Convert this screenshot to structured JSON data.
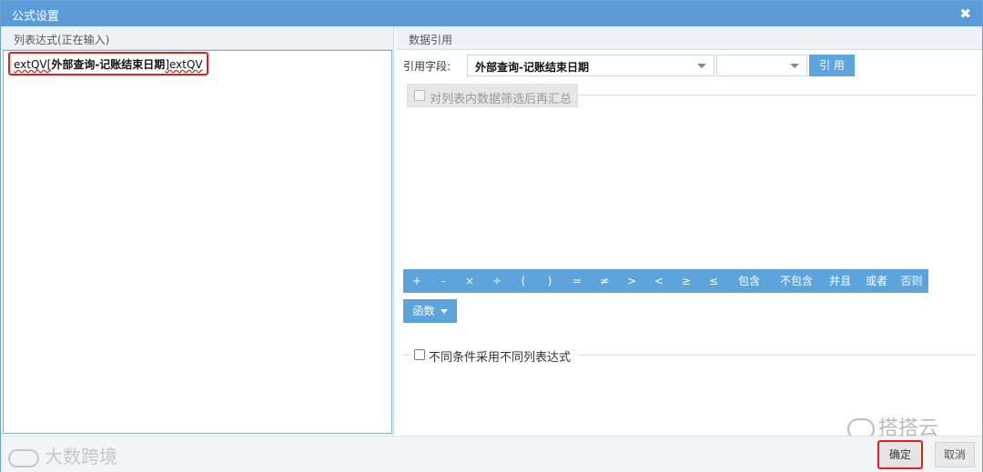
{
  "dialog": {
    "title": "公式设置",
    "close_glyph": "✖"
  },
  "left_pane": {
    "header": "列表达式(正在输入)",
    "expression": {
      "prefix": "extQV[",
      "field": "外部查询-记账结束日期",
      "suffix": "]extQV"
    }
  },
  "right_pane": {
    "header": "数据引用",
    "ref_label": "引用字段:",
    "ref_field_value": "外部查询-记账结束日期",
    "ref_sub_value": "",
    "ref_button": "引 用",
    "filter_checkbox_label": "对列表内数据筛选后再汇总",
    "operators": [
      "+",
      "-",
      "×",
      "÷",
      "(",
      ")",
      "=",
      "≠",
      ">",
      "<",
      "≥",
      "≤",
      "包含",
      "不包含",
      "并且",
      "或者",
      "否则"
    ],
    "function_button": "函数",
    "condition_checkbox_label": "不同条件采用不同列表达式"
  },
  "footer": {
    "ok_label": "确定",
    "cancel_label": "取消"
  },
  "watermarks": {
    "left": "大数跨境",
    "right": "搭搭云"
  },
  "colors": {
    "title_bar": "#5b9bd8",
    "button_blue": "#5da4dd",
    "highlight_red": "#e02020"
  }
}
